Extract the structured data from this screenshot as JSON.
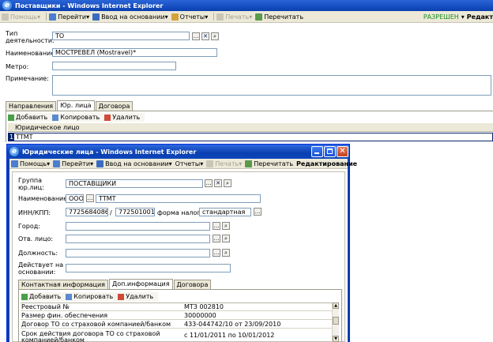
{
  "main": {
    "title": "Поставщики - Windows Internet Explorer",
    "toolbar": {
      "help": "Помощь",
      "go": "Перейти",
      "based": "Ввод на основании",
      "reports": "Отчеты",
      "print": "Печать",
      "reread": "Перечитать",
      "status": "РАЗРЕШЕН",
      "mode": "Редакт"
    },
    "form": {
      "type_label": "Тип деятельности:",
      "type_value": "ТО",
      "name_label": "Наименование:",
      "name_value": "МОСТРЕВЕЛ (Mostravel)*",
      "metro_label": "Метро:",
      "note_label": "Примечание:"
    },
    "tabs": [
      "Направления",
      "Юр. лица",
      "Договора"
    ],
    "grid": {
      "add": "Добавить",
      "copy": "Копировать",
      "delete": "Удалить",
      "header": "Юридическое лицо",
      "row_num": "1",
      "row_value": "ТТМТ"
    }
  },
  "popup": {
    "title": "Юридические лица - Windows Internet Explorer",
    "toolbar": {
      "help": "Помощь",
      "go": "Перейти",
      "based": "Ввод на основании",
      "reports": "Отчеты",
      "print": "Печать",
      "reread": "Перечитать",
      "mode": "Редактирование"
    },
    "form": {
      "group_label": "Группа юр.лиц:",
      "group_value": "ПОСТАВЩИКИ",
      "name_label": "Наименование:",
      "prefix_value": "ООО",
      "name_value": "ТТМТ",
      "inn_label": "ИНН/КПП:",
      "inn_value": "7725684086",
      "slash": "/",
      "kpp_value": "772501001",
      "tax_label": "форма налог.:",
      "tax_value": "стандартная",
      "city_label": "Город:",
      "resp_label": "Отв. лицо:",
      "position_label": "Должность:",
      "basis_label": "Действует на основании:"
    },
    "tabs": [
      "Контактная информация",
      "Доп.информация",
      "Договора"
    ],
    "grid": {
      "add": "Добавить",
      "copy": "Копировать",
      "delete": "Удалить",
      "rows": [
        {
          "label": "Реестровый №",
          "value": "МТЗ 002810"
        },
        {
          "label": "Размер фин. обеспечения",
          "value": "30000000"
        },
        {
          "label": "Договор ТО со страховой компанией/банком",
          "value": "433-044742/10 от 23/09/2010"
        },
        {
          "label": "Срок действия договора ТО со страховой компанией/банком",
          "value": "с 11/01/2011 по 10/01/2012"
        }
      ]
    }
  },
  "colors": {
    "title_blue": "#0a3fb0",
    "status_green": "#1a8a1a",
    "selected_row": "#0a246a"
  }
}
